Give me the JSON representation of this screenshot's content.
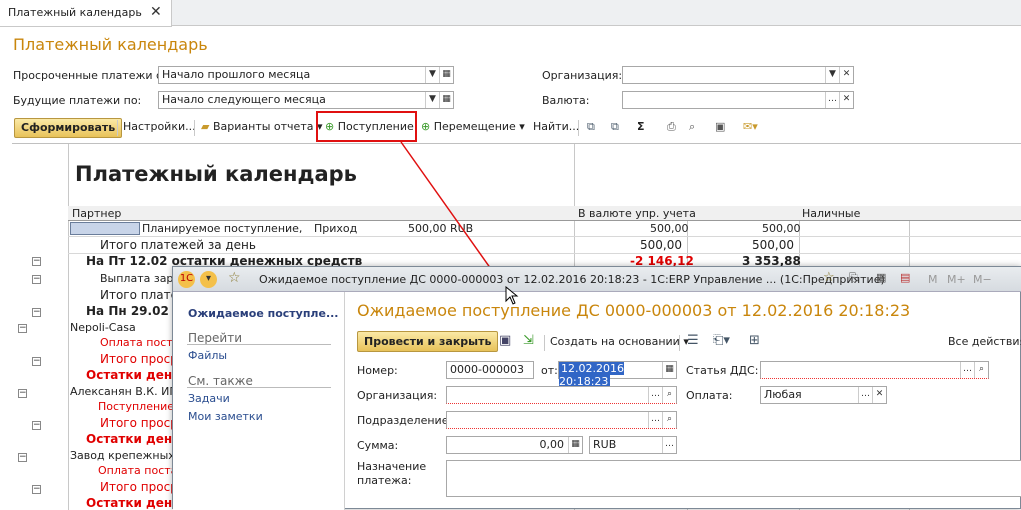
{
  "tab": {
    "label": "Платежный календарь",
    "close": "✕"
  },
  "page": {
    "title": "Платежный календарь"
  },
  "filters": {
    "overdue_label": "Просроченные платежи с:",
    "overdue_value": "Начало прошлого месяца",
    "future_label": "Будущие платежи по:",
    "future_value": "Начало следующего месяца",
    "org_label": "Организация:",
    "org_value": "",
    "currency_label": "Валюта:",
    "currency_value": ""
  },
  "toolbar": {
    "form": "Сформировать",
    "settings": "Настройки...",
    "variants": "Варианты отчета",
    "income": "Поступление",
    "move": "Перемещение",
    "find": "Найти...",
    "sum": "Σ"
  },
  "report": {
    "title": "Платежный календарь",
    "col_partner": "Партнер",
    "col_mgmt": "В валюте упр. учета",
    "col_cash": "Наличные",
    "rows": [
      {
        "a": "Планируемое поступление,",
        "b": "Приход",
        "c": "500,00 RUB",
        "d": "500,00",
        "e": "500,00"
      },
      {
        "a": "Итого платежей за день",
        "d": "500,00",
        "e": "500,00"
      },
      {
        "a": "На Пт 12.02 остатки денежных средств",
        "d": "-2 146,12",
        "e": "3 353,88"
      },
      {
        "a": "Выплата зара"
      },
      {
        "a": "Итого плате"
      },
      {
        "a": "На Пн 29.02 о"
      },
      {
        "a": "Nepoli-Casa"
      },
      {
        "a": "Оплата поста"
      },
      {
        "a": "Итого проср"
      },
      {
        "a": "Остатки дене"
      },
      {
        "a": "Алексанян В.К. ИП"
      },
      {
        "a": "Поступление"
      },
      {
        "a": "Итого проср"
      },
      {
        "a": "Остатки дене"
      },
      {
        "a": "Завод крепежных и"
      },
      {
        "a": "Оплата поста"
      },
      {
        "a": "Итого проср"
      },
      {
        "a": "Остатки дене"
      }
    ]
  },
  "doc": {
    "window_title": "Ожидаемое поступление ДС 0000-000003 от 12.02.2016 20:18:23 - 1С:ERP Управление ...  (1С:Предприятие)",
    "title": "Ожидаемое поступление ДС 0000-000003 от 12.02.2016 20:18:23",
    "side_current": "Ожидаемое поступле...",
    "side_goto": "Перейти",
    "side_files": "Файлы",
    "side_see": "См. также",
    "side_tasks": "Задачи",
    "side_notes": "Мои заметки",
    "post_close": "Провести и закрыть",
    "create_based": "Создать на основании",
    "all_actions": "Все действия",
    "number_label": "Номер:",
    "number_value": "0000-000003",
    "from_label": "от:",
    "date_value": "12.02.2016 20:18:23",
    "dds_label": "Статья ДДС:",
    "dds_value": "",
    "org_label": "Организация:",
    "org_value": "",
    "payment_label": "Оплата:",
    "payment_value": "Любая",
    "dept_label": "Подразделение:",
    "dept_value": "",
    "sum_label": "Сумма:",
    "sum_value": "0,00",
    "currency_value": "RUB",
    "purpose_label": "Назначение платежа:",
    "purpose_value": ""
  },
  "icons": {
    "mem": "M",
    "mem_plus": "M+",
    "mem_minus": "M−"
  }
}
